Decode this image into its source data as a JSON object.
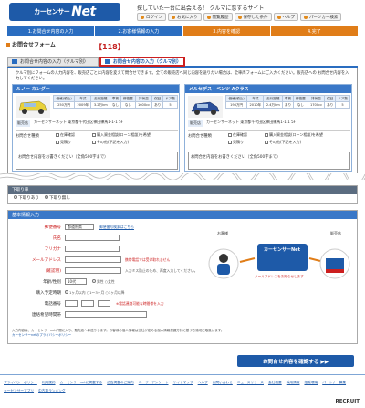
{
  "header": {
    "logo_prefix": "カーセンサー",
    "logo_main": "Net",
    "tagline": "探していた一台に出会える！ クルマに恋するサイト",
    "links": [
      "ログイン",
      "お気に入り",
      "閲覧履歴",
      "保存した条件",
      "ヘルプ",
      "パーツカー検索"
    ]
  },
  "steps": [
    "1.お問合せ内容の入力",
    "2.お客様情報の入力",
    "3.内容を確認",
    "4.完了"
  ],
  "page_title": "お問合せフォーム",
  "annotation_badge": "【118】",
  "tabs": {
    "tab1": "お問合せ内容の入力（クルマ別）",
    "tab2": "お問合せ内容の入力（クルマ別）"
  },
  "intro_text": "クルマ別にフォームの入力内容を、販売店ごとに内容を変えて問合せできます。全ての販売店へ同じ内容を送りたい場合は、全車両フォームにご入力ください。販売店への お問合せ内容を入力してください。",
  "cars": [
    {
      "name": "ルノー カングー",
      "dealer_label": "販売店",
      "dealer": "カーセンサーネット 東京都千代田区神田練馬1-1-1 5F",
      "headers": [
        "価格(税込)",
        "年式",
        "走行距離",
        "車検",
        "修復歴",
        "排気量",
        "保証",
        "ドア数"
      ],
      "values": [
        "250万円",
        "2009年",
        "3.2万km",
        "なし",
        "なし",
        "1600cc",
        "あり",
        "5"
      ]
    },
    {
      "name": "メルセデス・ベンツ Aクラス",
      "dealer_label": "販売店",
      "dealer": "カーセンサーネット 東京都千代田区神田練馬1-1-1 5F",
      "headers": [
        "価格(税込)",
        "年式",
        "走行距離",
        "車検",
        "修復歴",
        "排気量",
        "保証",
        "ドア数"
      ],
      "values": [
        "198万円",
        "2010年",
        "2.4万km",
        "あり",
        "なし",
        "1700cc",
        "あり",
        "5"
      ]
    }
  ],
  "inquiry": {
    "label": "お問合せ種類",
    "options": [
      "在庫確認",
      "見積り",
      "来店予約",
      "購入資金相談(ローン相談)を希望",
      "その他(下記を入力)"
    ],
    "textarea": "お問合せ内容をお書きください（全角500字まで）"
  },
  "shipping": {
    "title": "下取り車",
    "options": [
      "下取りあり",
      "下取り無し"
    ]
  },
  "info": {
    "title": "基本情報入力",
    "fields": [
      {
        "label": "郵便番号",
        "value": "都道府県",
        "note": "郵便番号検索はこちら"
      },
      {
        "label": "氏名",
        "value": "",
        "note": ""
      },
      {
        "label": "フリガナ",
        "value": "",
        "note": ""
      },
      {
        "label": "メールアドレス",
        "value": "",
        "note": "携帯電話では受け取れません"
      },
      {
        "label": "(確認用)",
        "value": "",
        "note": "入力ミス防止のため、再度入力してください。"
      },
      {
        "label": "年齢/性別",
        "value": "10代",
        "note": "男性 ○女性"
      },
      {
        "label": "購入予定時期",
        "value": "",
        "note": "1ヶ月以内 ○1〜3ヶ月 ○3ヶ月以降"
      },
      {
        "label": "電話番号",
        "value": "",
        "note": "※電話連絡可能な時間帯を入力"
      },
      {
        "label": "連絡希望時間帯",
        "value": "",
        "note": ""
      }
    ],
    "mail_link": "メールアドレスの入力について",
    "illus_mid": "カーセンサーNet",
    "illus_left": "お客様",
    "illus_right": "販売店",
    "illus_note": "メールアドレスをお知らせします"
  },
  "privacy": {
    "text": "入力内容は、カーセンサーnetが間に入り、販売店へお送りします。お客様の個人情報は当社が定める個人情報保護方針に基づき適切に取扱います。",
    "link": "カーセンサーnetのプライバシーポリシー"
  },
  "confirm_label": "お問合せ内容を確認する ▶▶",
  "footer_links": [
    "プライバシーポリシー",
    "利用規約",
    "カーセンサーnetに掲載する",
    "広告掲載のご案内",
    "ユーザーアンケート",
    "サイトマップ",
    "ヘルプ",
    "お問い合わせ",
    "ニュースリリース",
    "会社概要",
    "採用情報",
    "推奨環境",
    "パートナー募集",
    "カーセンサーアプリ",
    "中古車ランキング"
  ],
  "copyright": "RECRUIT"
}
